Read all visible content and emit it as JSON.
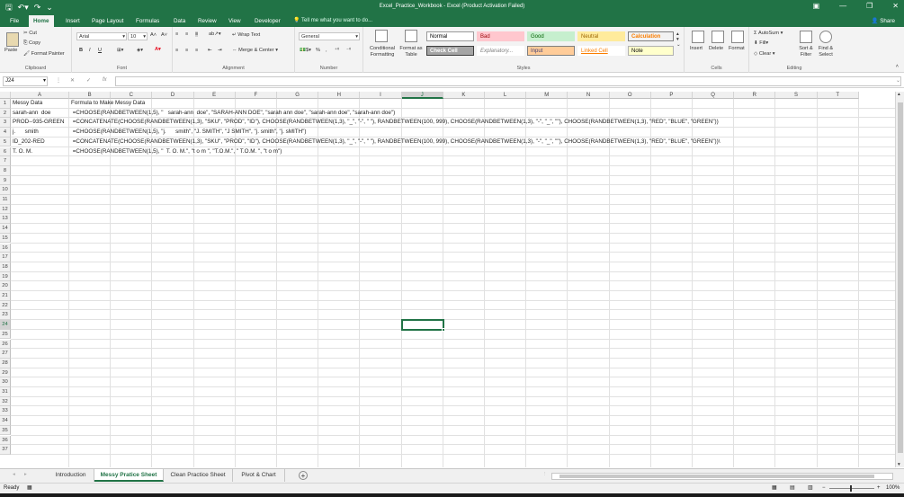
{
  "window": {
    "title": "Excel_Practice_Workbook - Excel (Product Activation Failed)",
    "quick_access": [
      "save-icon",
      "undo-icon",
      "redo-icon",
      "customize-icon"
    ],
    "controls": [
      "ribbon-display-icon",
      "minimize-icon",
      "restore-icon",
      "close-icon"
    ]
  },
  "menu": {
    "tabs": [
      "File",
      "Home",
      "Insert",
      "Page Layout",
      "Formulas",
      "Data",
      "Review",
      "View",
      "Developer"
    ],
    "active": "Home",
    "tell_me": "Tell me what you want to do...",
    "share": "Share"
  },
  "ribbon": {
    "clipboard": {
      "label": "Clipboard",
      "paste": "Paste",
      "cut": "Cut",
      "copy": "Copy",
      "format_painter": "Format Painter"
    },
    "font": {
      "label": "Font",
      "font_name": "Arial",
      "font_size": "10",
      "bold": "B",
      "italic": "I",
      "underline": "U",
      "font_color": "#e81123",
      "fill_color": "#ffff00"
    },
    "alignment": {
      "label": "Alignment",
      "wrap_text": "Wrap Text",
      "merge_center": "Merge & Center"
    },
    "number": {
      "label": "Number",
      "format": "General",
      "currency": "$",
      "percent": "%",
      "comma": ","
    },
    "styles": {
      "label": "Styles",
      "conditional_formatting": "Conditional Formatting",
      "format_as_table": "Format as Table",
      "cells": [
        {
          "name": "Normal",
          "bg": "#ffffff",
          "fg": "#000000",
          "border": "#999999"
        },
        {
          "name": "Bad",
          "bg": "#ffc7ce",
          "fg": "#9c0006",
          "border": "#ffc7ce"
        },
        {
          "name": "Good",
          "bg": "#c6efce",
          "fg": "#006100",
          "border": "#c6efce"
        },
        {
          "name": "Neutral",
          "bg": "#ffeb9c",
          "fg": "#9c6500",
          "border": "#ffeb9c"
        },
        {
          "name": "Calculation",
          "bg": "#f2f2f2",
          "fg": "#fa7d00",
          "border": "#7f7f7f"
        },
        {
          "name": "Check Cell",
          "bg": "#a5a5a5",
          "fg": "#ffffff",
          "border": "#3f3f3f"
        },
        {
          "name": "Explanatory...",
          "bg": "#ffffff",
          "fg": "#7f7f7f",
          "border": "#ffffff"
        },
        {
          "name": "Input",
          "bg": "#ffcc99",
          "fg": "#3f3f76",
          "border": "#7f7f7f"
        },
        {
          "name": "Linked Cell",
          "bg": "#ffffff",
          "fg": "#fa7d00",
          "border": "#ffffff"
        },
        {
          "name": "Note",
          "bg": "#ffffcc",
          "fg": "#000000",
          "border": "#b2b2b2"
        }
      ]
    },
    "cells": {
      "label": "Cells",
      "insert": "Insert",
      "delete": "Delete",
      "format": "Format"
    },
    "editing": {
      "label": "Editing",
      "autosum": "AutoSum",
      "fill": "Fill",
      "clear": "Clear",
      "sort_filter": "Sort & Filter",
      "find_select": "Find & Select"
    }
  },
  "formula_bar": {
    "name_box": "J24",
    "cancel": "✕",
    "enter": "✓",
    "fx": "fx",
    "value": ""
  },
  "sheet": {
    "columns": [
      "A",
      "B",
      "C",
      "D",
      "E",
      "F",
      "G",
      "H",
      "I",
      "J",
      "K",
      "L",
      "M",
      "N",
      "O",
      "P",
      "Q",
      "R",
      "S",
      "T"
    ],
    "rows": [
      "1",
      "2",
      "3",
      "4",
      "5",
      "6",
      "7",
      "8",
      "9",
      "10",
      "11",
      "12",
      "13",
      "14",
      "15",
      "16",
      "17",
      "18",
      "19",
      "20",
      "21",
      "22",
      "23",
      "24",
      "25",
      "26",
      "27",
      "28",
      "29",
      "30",
      "31",
      "32",
      "33",
      "34",
      "35",
      "36",
      "37"
    ],
    "selected_column": "J",
    "selected_row": "24",
    "data": [
      {
        "a": "Messy Data",
        "b": "Formula to Make Messy Data"
      },
      {
        "a": "sarah-ann  doe",
        "b": " =CHOOSE(RANDBETWEEN(1,5), \"   sarah-ann  doe\", \"SARAH-ANN DOE\", \"sarah ann doe\", \"sarah-ann doe\", \"sarah-ann doe\")"
      },
      {
        "a": "PROD--935-GREEN",
        "b": " =CONCATENATE(CHOOSE(RANDBETWEEN(1,3), \"SKU\", \"PROD\", \"ID\"), CHOOSE(RANDBETWEEN(1,3), \"_\", \"-\", \" \"), RANDBETWEEN(100, 999), CHOOSE(RANDBETWEEN(1,3), \"-\", \"_\", \"\"), CHOOSE(RANDBETWEEN(1,3), \"RED\", \"BLUE\", \"GREEN\"))"
      },
      {
        "a": "j.      smith",
        "b": " =CHOOSE(RANDBETWEEN(1,5), \"j.      smith\", \"J. SMITH\", \"J SMITH\", \"j. smith\", \"j. sMITH\")"
      },
      {
        "a": "ID_202-RED",
        "b": " =CONCATENATE(CHOOSE(RANDBETWEEN(1,3), \"SKU\", \"PROD\", \"ID\"), CHOOSE(RANDBETWEEN(1,3), \"_\", \"-\", \" \"), RANDBETWEEN(100, 999), CHOOSE(RANDBETWEEN(1,3), \"-\", \"_\", \"\"), CHOOSE(RANDBETWEEN(1,3), \"RED\", \"BLUE\", \"GREEN\"))\\"
      },
      {
        "a": "T. O. M.",
        "b": " =CHOOSE(RANDBETWEEN(1,5), \"  T. O. M.\", \"t o m \", \"T.O.M.\", \" T.O.M. \", \"t o m\")"
      }
    ]
  },
  "sheet_tabs": {
    "tabs": [
      "Introduction",
      "Messy Pratice Sheet",
      "Clean Practice Sheet",
      "Pivot & Chart"
    ],
    "active": "Messy Pratice Sheet",
    "add": "+"
  },
  "status_bar": {
    "ready": "Ready",
    "zoom": "100%",
    "zoom_out": "−",
    "zoom_in": "+"
  },
  "colors": {
    "accent": "#217346",
    "gridline": "#e1e1e1"
  }
}
